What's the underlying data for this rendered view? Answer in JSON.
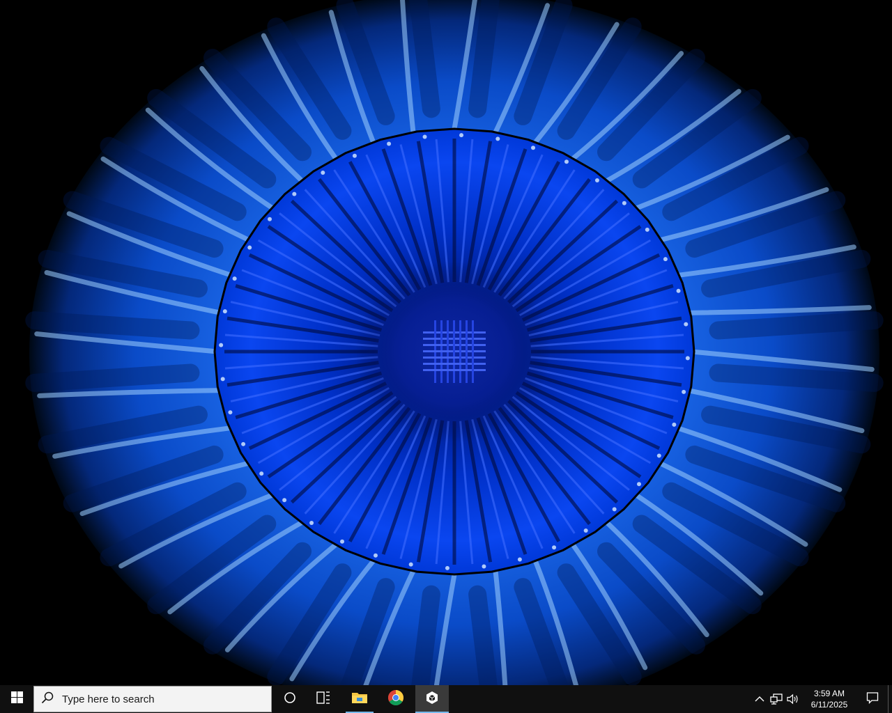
{
  "desktop": {
    "wallpaper": "blue-iris-fractal",
    "colors": {
      "outer_dark": "#001a66",
      "outer_mid": "#0a4fd6",
      "outer_light": "#6fb8ff",
      "inner_dark": "#000d4d",
      "inner_mid": "#0033cc",
      "rim": "#000000"
    }
  },
  "taskbar": {
    "start_icon": "windows-logo-icon",
    "search": {
      "placeholder": "Type here to search",
      "icon": "search-icon"
    },
    "buttons": [
      {
        "name": "cortana",
        "icon": "circle-icon"
      },
      {
        "name": "task-view",
        "icon": "task-view-icon"
      },
      {
        "name": "file-explorer",
        "icon": "folder-icon"
      },
      {
        "name": "chrome",
        "icon": "chrome-icon"
      },
      {
        "name": "unity-hub",
        "icon": "cube-icon"
      }
    ],
    "tray": {
      "chevron_icon": "chevron-up-icon",
      "network_icon": "network-icon",
      "volume_icon": "volume-icon",
      "time": "3:59 AM",
      "date": "6/11/2025",
      "notification_icon": "notification-icon"
    },
    "accent": "#76b9ed",
    "background": "#101010"
  }
}
